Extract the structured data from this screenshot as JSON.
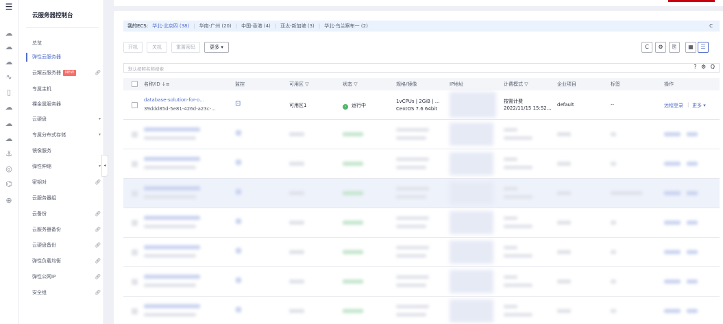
{
  "rail": {
    "icons": [
      "menu-icon",
      "cloud-icon",
      "cloud-icon",
      "cloud-icon",
      "chart-icon",
      "file-icon",
      "cloud-icon",
      "cloud-icon",
      "cloud-icon",
      "anchor-icon",
      "target-icon",
      "network-icon",
      "globe-icon"
    ]
  },
  "subnav": {
    "title": "云服务器控制台",
    "items": [
      {
        "label": "总览"
      },
      {
        "label": "弹性云服务器",
        "active": true
      },
      {
        "label": "云耀云服务器",
        "badge": "NEW",
        "link": true
      },
      {
        "label": "专属主机"
      },
      {
        "label": "裸金属服务器"
      },
      {
        "label": "云硬盘",
        "chevron": true
      },
      {
        "label": "专属分布式存储",
        "chevron": true
      },
      {
        "label": "镜像服务"
      },
      {
        "label": "弹性伸缩",
        "chevron": true
      },
      {
        "label": "密钥对",
        "link": true
      },
      {
        "label": "云服务器组"
      },
      {
        "label": "云备份",
        "link": true
      },
      {
        "label": "云服务器备份",
        "link": true
      },
      {
        "label": "云硬盘备份",
        "link": true
      },
      {
        "label": "弹性负载均衡",
        "link": true
      },
      {
        "label": "弹性公网IP",
        "link": true
      },
      {
        "label": "安全组",
        "link": true
      }
    ]
  },
  "regions": {
    "label": "我的ECS:",
    "items": [
      {
        "label": "华北-北京四 (38)",
        "selected": true
      },
      {
        "label": "华南-广州 (20)"
      },
      {
        "label": "中国-香港 (4)"
      },
      {
        "label": "亚太-新加坡 (3)"
      },
      {
        "label": "华北-乌兰察布一 (2)"
      }
    ],
    "refresh_glyph": "C"
  },
  "toolbar": {
    "start": "开机",
    "stop": "关机",
    "reset_password": "重置密码",
    "more": "更多 ▾",
    "icons": {
      "refresh": "C",
      "settings": "⚙",
      "export": "⎘",
      "grid": "▦",
      "list": "☰"
    }
  },
  "search": {
    "placeholder": "默认按照名称搜索",
    "icons": "? ⚙ Q"
  },
  "table": {
    "columns": {
      "name": "名称/ID ↓≡",
      "monitor": "监控",
      "az": "可用区 ▽",
      "status": "状态 ▽",
      "spec": "规格/镜像",
      "ip": "IP地址",
      "billing": "计费模式 ▽",
      "project": "企业项目",
      "tags": "标签",
      "ops": "操作"
    },
    "first_row": {
      "name": "database-solution-for-o...",
      "id": "39ddd85d-5e81-426d-a23c-...",
      "monitor_icon": "monitor-icon",
      "az": "可用区1",
      "status": "运行中",
      "spec_line1": "1vCPUs | 2GiB | ...",
      "spec_line2": "CentOS 7.6 64bit",
      "billing_line1": "按需计费",
      "billing_line2": "2022/11/15 15:52...",
      "project": "default",
      "tags": "--",
      "op_remote": "远程登录",
      "op_more": "更多 ▾"
    }
  },
  "colors": {
    "accent": "#526ecc",
    "running": "#50b36b",
    "region_bg": "#eaf2fe",
    "new_badge": "#f66f6a",
    "top_red": "#c7000b"
  }
}
